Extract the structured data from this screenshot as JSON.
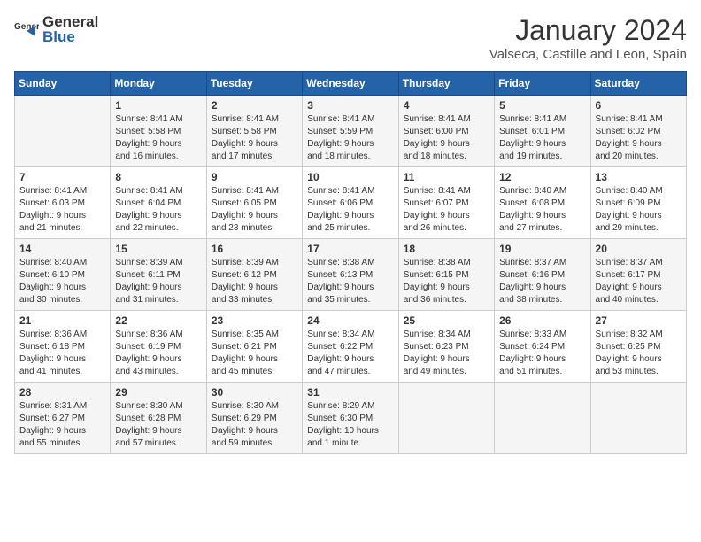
{
  "header": {
    "logo_general": "General",
    "logo_blue": "Blue",
    "month_title": "January 2024",
    "location": "Valseca, Castille and Leon, Spain"
  },
  "days_of_week": [
    "Sunday",
    "Monday",
    "Tuesday",
    "Wednesday",
    "Thursday",
    "Friday",
    "Saturday"
  ],
  "weeks": [
    [
      {
        "day": "",
        "content": ""
      },
      {
        "day": "1",
        "content": "Sunrise: 8:41 AM\nSunset: 5:58 PM\nDaylight: 9 hours\nand 16 minutes."
      },
      {
        "day": "2",
        "content": "Sunrise: 8:41 AM\nSunset: 5:58 PM\nDaylight: 9 hours\nand 17 minutes."
      },
      {
        "day": "3",
        "content": "Sunrise: 8:41 AM\nSunset: 5:59 PM\nDaylight: 9 hours\nand 18 minutes."
      },
      {
        "day": "4",
        "content": "Sunrise: 8:41 AM\nSunset: 6:00 PM\nDaylight: 9 hours\nand 18 minutes."
      },
      {
        "day": "5",
        "content": "Sunrise: 8:41 AM\nSunset: 6:01 PM\nDaylight: 9 hours\nand 19 minutes."
      },
      {
        "day": "6",
        "content": "Sunrise: 8:41 AM\nSunset: 6:02 PM\nDaylight: 9 hours\nand 20 minutes."
      }
    ],
    [
      {
        "day": "7",
        "content": "Sunrise: 8:41 AM\nSunset: 6:03 PM\nDaylight: 9 hours\nand 21 minutes."
      },
      {
        "day": "8",
        "content": "Sunrise: 8:41 AM\nSunset: 6:04 PM\nDaylight: 9 hours\nand 22 minutes."
      },
      {
        "day": "9",
        "content": "Sunrise: 8:41 AM\nSunset: 6:05 PM\nDaylight: 9 hours\nand 23 minutes."
      },
      {
        "day": "10",
        "content": "Sunrise: 8:41 AM\nSunset: 6:06 PM\nDaylight: 9 hours\nand 25 minutes."
      },
      {
        "day": "11",
        "content": "Sunrise: 8:41 AM\nSunset: 6:07 PM\nDaylight: 9 hours\nand 26 minutes."
      },
      {
        "day": "12",
        "content": "Sunrise: 8:40 AM\nSunset: 6:08 PM\nDaylight: 9 hours\nand 27 minutes."
      },
      {
        "day": "13",
        "content": "Sunrise: 8:40 AM\nSunset: 6:09 PM\nDaylight: 9 hours\nand 29 minutes."
      }
    ],
    [
      {
        "day": "14",
        "content": "Sunrise: 8:40 AM\nSunset: 6:10 PM\nDaylight: 9 hours\nand 30 minutes."
      },
      {
        "day": "15",
        "content": "Sunrise: 8:39 AM\nSunset: 6:11 PM\nDaylight: 9 hours\nand 31 minutes."
      },
      {
        "day": "16",
        "content": "Sunrise: 8:39 AM\nSunset: 6:12 PM\nDaylight: 9 hours\nand 33 minutes."
      },
      {
        "day": "17",
        "content": "Sunrise: 8:38 AM\nSunset: 6:13 PM\nDaylight: 9 hours\nand 35 minutes."
      },
      {
        "day": "18",
        "content": "Sunrise: 8:38 AM\nSunset: 6:15 PM\nDaylight: 9 hours\nand 36 minutes."
      },
      {
        "day": "19",
        "content": "Sunrise: 8:37 AM\nSunset: 6:16 PM\nDaylight: 9 hours\nand 38 minutes."
      },
      {
        "day": "20",
        "content": "Sunrise: 8:37 AM\nSunset: 6:17 PM\nDaylight: 9 hours\nand 40 minutes."
      }
    ],
    [
      {
        "day": "21",
        "content": "Sunrise: 8:36 AM\nSunset: 6:18 PM\nDaylight: 9 hours\nand 41 minutes."
      },
      {
        "day": "22",
        "content": "Sunrise: 8:36 AM\nSunset: 6:19 PM\nDaylight: 9 hours\nand 43 minutes."
      },
      {
        "day": "23",
        "content": "Sunrise: 8:35 AM\nSunset: 6:21 PM\nDaylight: 9 hours\nand 45 minutes."
      },
      {
        "day": "24",
        "content": "Sunrise: 8:34 AM\nSunset: 6:22 PM\nDaylight: 9 hours\nand 47 minutes."
      },
      {
        "day": "25",
        "content": "Sunrise: 8:34 AM\nSunset: 6:23 PM\nDaylight: 9 hours\nand 49 minutes."
      },
      {
        "day": "26",
        "content": "Sunrise: 8:33 AM\nSunset: 6:24 PM\nDaylight: 9 hours\nand 51 minutes."
      },
      {
        "day": "27",
        "content": "Sunrise: 8:32 AM\nSunset: 6:25 PM\nDaylight: 9 hours\nand 53 minutes."
      }
    ],
    [
      {
        "day": "28",
        "content": "Sunrise: 8:31 AM\nSunset: 6:27 PM\nDaylight: 9 hours\nand 55 minutes."
      },
      {
        "day": "29",
        "content": "Sunrise: 8:30 AM\nSunset: 6:28 PM\nDaylight: 9 hours\nand 57 minutes."
      },
      {
        "day": "30",
        "content": "Sunrise: 8:30 AM\nSunset: 6:29 PM\nDaylight: 9 hours\nand 59 minutes."
      },
      {
        "day": "31",
        "content": "Sunrise: 8:29 AM\nSunset: 6:30 PM\nDaylight: 10 hours\nand 1 minute."
      },
      {
        "day": "",
        "content": ""
      },
      {
        "day": "",
        "content": ""
      },
      {
        "day": "",
        "content": ""
      }
    ]
  ]
}
